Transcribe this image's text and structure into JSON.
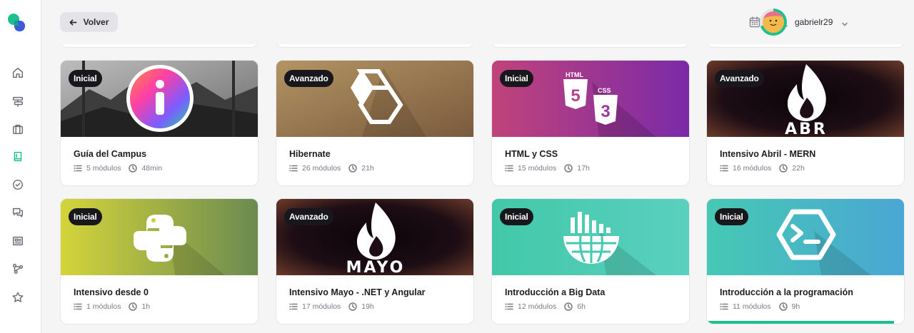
{
  "topbar": {
    "back_label": "Volver",
    "username": "gabrielr29"
  },
  "sidebar": {
    "items": [
      {
        "icon": "home-icon",
        "active": false
      },
      {
        "icon": "roadmap-icon",
        "active": false
      },
      {
        "icon": "briefcase-icon",
        "active": false
      },
      {
        "icon": "book-icon",
        "active": true
      },
      {
        "icon": "badge-check-icon",
        "active": false
      },
      {
        "icon": "chat-icon",
        "active": false
      },
      {
        "icon": "news-icon",
        "active": false
      },
      {
        "icon": "network-icon",
        "active": false
      },
      {
        "icon": "star-icon",
        "active": false
      }
    ]
  },
  "courses": [
    {
      "level": "Inicial",
      "title": "Guía del Campus",
      "modules": "5 módulos",
      "duration": "48min",
      "art": "info",
      "bg": "#8a8a8a"
    },
    {
      "level": "Avanzado",
      "title": "Hibernate",
      "modules": "26 módulos",
      "duration": "21h",
      "art": "hibernate",
      "bg": "#9c7c55"
    },
    {
      "level": "Inicial",
      "title": "HTML y CSS",
      "modules": "15 módulos",
      "duration": "17h",
      "art": "html",
      "bg": "#a03a8a"
    },
    {
      "level": "Avanzado",
      "title": "Intensivo Abril - MERN",
      "modules": "16 módulos",
      "duration": "22h",
      "art": "flame",
      "art_text": "ABR",
      "bg": "#1c0f14"
    },
    {
      "level": "Inicial",
      "title": "Intensivo desde 0",
      "modules": "1 módulos",
      "duration": "1h",
      "art": "python",
      "bg": "#b7c23a"
    },
    {
      "level": "Avanzado",
      "title": "Intensivo Mayo - .NET y Angular",
      "modules": "17 módulos",
      "duration": "19h",
      "art": "flame",
      "art_text": "MAYO",
      "bg": "#1c0f14"
    },
    {
      "level": "Inicial",
      "title": "Introducción a Big Data",
      "modules": "12 módulos",
      "duration": "6h",
      "art": "bigdata",
      "bg": "#45c9b0"
    },
    {
      "level": "Inicial",
      "title": "Introducción a la programación",
      "modules": "11 módulos",
      "duration": "9h",
      "art": "terminal",
      "bg": "#4ab8c8",
      "progress": 0.95
    }
  ],
  "colors": {
    "accent": "#1dbf8f",
    "badge_bg": "#17171c"
  }
}
